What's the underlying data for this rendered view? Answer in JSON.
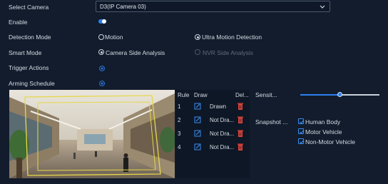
{
  "form": {
    "camera_label": "Select Camera",
    "camera_value": "D3(IP Camera 03)",
    "enable_label": "Enable",
    "enable_on": true,
    "detection_mode_label": "Detection Mode",
    "detection_mode_options": [
      "Motion",
      "Ultra Motion Detection"
    ],
    "detection_mode_selected": "Ultra Motion Detection",
    "smart_mode_label": "Smart Mode",
    "smart_mode_options": [
      "Camera Side Analysis",
      "NVR Side Analysis"
    ],
    "smart_mode_selected": "Camera Side Analysis",
    "trigger_actions_label": "Trigger Actions",
    "arming_schedule_label": "Arming Schedule"
  },
  "rules_table": {
    "headers": [
      "Rule",
      "Draw",
      "Del..."
    ],
    "rows": [
      {
        "rule": "1",
        "status": "Drawn"
      },
      {
        "rule": "2",
        "status": "Not Dra..."
      },
      {
        "rule": "3",
        "status": "Not Dra..."
      },
      {
        "rule": "4",
        "status": "Not Dra..."
      }
    ]
  },
  "sensitivity": {
    "label": "Sensit...",
    "level_fraction": 0.5
  },
  "snapshot": {
    "label": "Snapshot ...",
    "options": [
      {
        "label": "Human Body",
        "checked": true
      },
      {
        "label": "Motor Vehicle",
        "checked": true
      },
      {
        "label": "Non-Motor Vehicle",
        "checked": true
      }
    ]
  },
  "colors": {
    "accent": "#2f80ed",
    "delete": "#e0453a",
    "background": "#121c2c"
  }
}
